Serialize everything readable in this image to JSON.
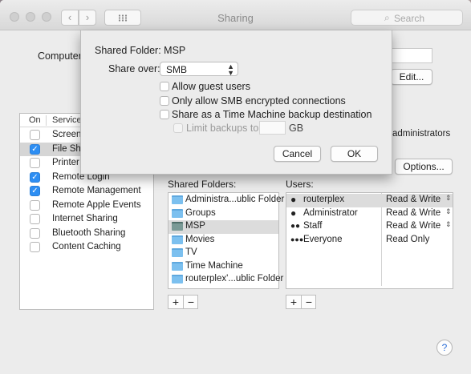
{
  "window": {
    "title": "Sharing",
    "search_placeholder": "Search",
    "nav_back": "‹",
    "nav_forward": "›"
  },
  "computer_name": {
    "label": "Computer",
    "edit_button": "Edit..."
  },
  "services": {
    "header_on": "On",
    "header_service": "Service",
    "items": [
      {
        "label": "Screen",
        "checked": false
      },
      {
        "label": "File Sha",
        "checked": true,
        "selected": true
      },
      {
        "label": "Printer",
        "checked": false
      },
      {
        "label": "Remote Login",
        "checked": true
      },
      {
        "label": "Remote Management",
        "checked": true
      },
      {
        "label": "Remote Apple Events",
        "checked": false
      },
      {
        "label": "Internet Sharing",
        "checked": false
      },
      {
        "label": "Bluetooth Sharing",
        "checked": false
      },
      {
        "label": "Content Caching",
        "checked": false
      }
    ]
  },
  "info_partial": "administrators",
  "options_button": "Options...",
  "shared_folders": {
    "label": "Shared Folders:",
    "items": [
      "Administra...ublic Folder",
      "Groups",
      "MSP",
      "Movies",
      "TV",
      "Time Machine",
      "routerplex'...ublic Folder"
    ],
    "selected_index": 2
  },
  "users": {
    "label": "Users:",
    "items": [
      {
        "name": "routerplex",
        "permission": "Read & Write",
        "icon": "user-icon"
      },
      {
        "name": "Administrator",
        "permission": "Read & Write",
        "icon": "user-icon"
      },
      {
        "name": "Staff",
        "permission": "Read & Write",
        "icon": "group-icon"
      },
      {
        "name": "Everyone",
        "permission": "Read Only",
        "icon": "everyone-icon"
      }
    ],
    "selected_index": 0
  },
  "plus": "+",
  "minus": "−",
  "help": "?",
  "sheet": {
    "shared_folder_label": "Shared Folder: MSP",
    "share_over_label": "Share over:",
    "share_over_value": "SMB",
    "allow_guest": "Allow guest users",
    "smb_encrypted": "Only allow SMB encrypted connections",
    "time_machine": "Share as a Time Machine backup destination",
    "limit_backups": "Limit backups to",
    "gb_unit": "GB",
    "cancel": "Cancel",
    "ok": "OK"
  },
  "colors": {
    "accent": "#2d8ef3",
    "selection": "#d5d5d5"
  }
}
